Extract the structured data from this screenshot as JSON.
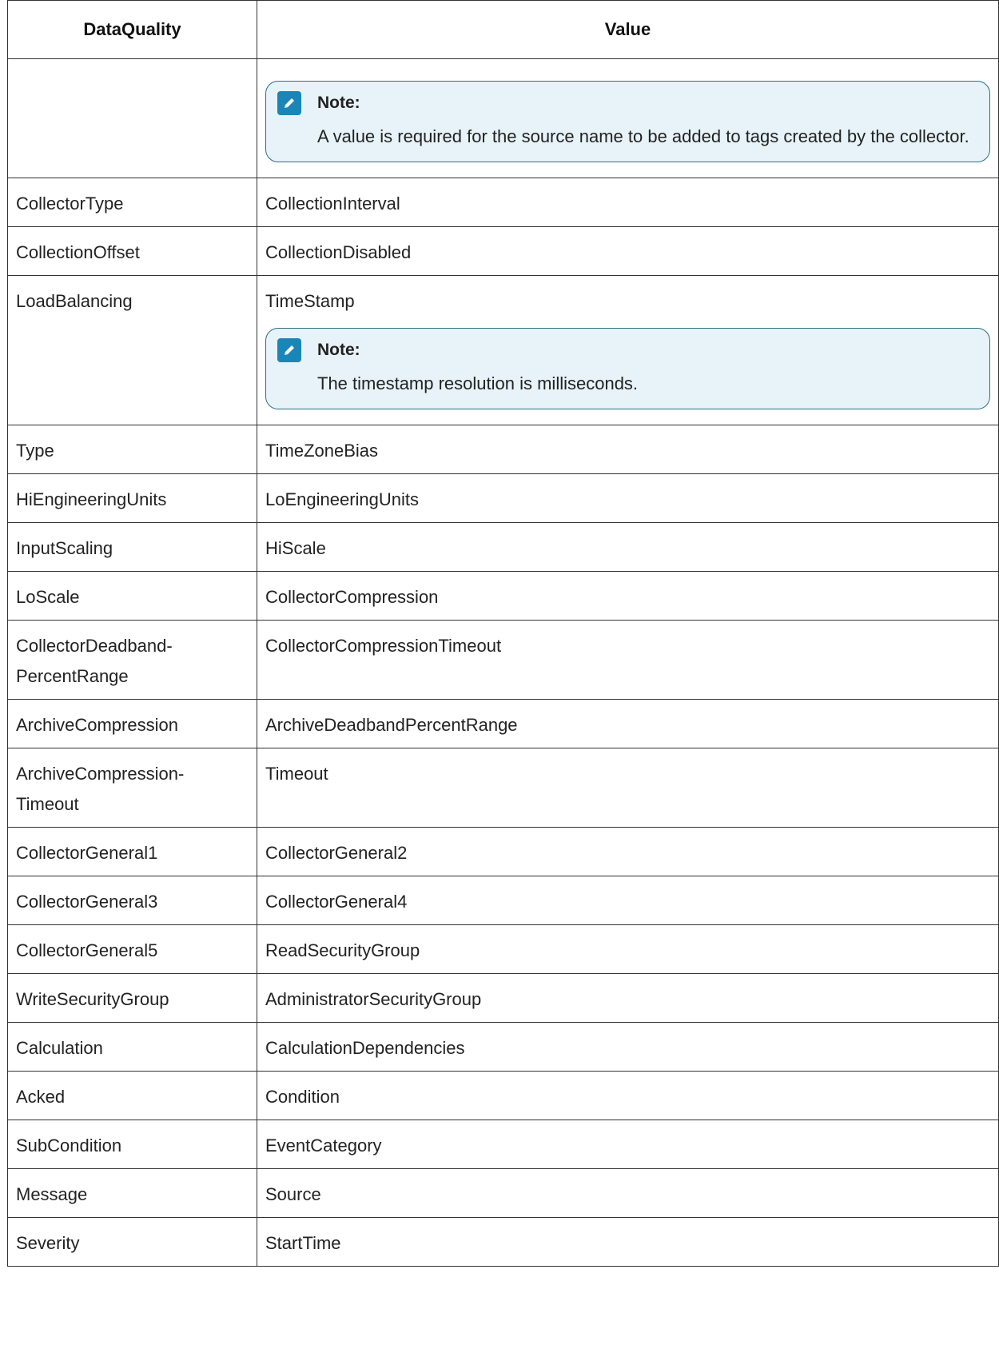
{
  "table": {
    "headers": [
      "DataQuality",
      "Value"
    ],
    "note_label": "Note:",
    "rows": [
      {
        "a": "",
        "b": "",
        "note": "A value is required for the source name to be added to tags created by the collector."
      },
      {
        "a": "CollectorType",
        "b": "CollectionInterval"
      },
      {
        "a": "CollectionOffset",
        "b": "CollectionDisabled"
      },
      {
        "a": "LoadBalancing",
        "b": "TimeStamp",
        "note": "The timestamp resolution is milliseconds."
      },
      {
        "a": "Type",
        "b": "TimeZoneBias"
      },
      {
        "a": "HiEngineeringUnits",
        "b": "LoEngineeringUnits"
      },
      {
        "a": "InputScaling",
        "b": "HiScale"
      },
      {
        "a": "LoScale",
        "b": "CollectorCompression"
      },
      {
        "a": "CollectorDeadband-\nPercentRange",
        "b": "CollectorCompressionTimeout"
      },
      {
        "a": "ArchiveCompression",
        "b": "ArchiveDeadbandPercentRange"
      },
      {
        "a": "ArchiveCompression-\nTimeout",
        "b": "Timeout"
      },
      {
        "a": "CollectorGeneral1",
        "b": "CollectorGeneral2"
      },
      {
        "a": "CollectorGeneral3",
        "b": "CollectorGeneral4"
      },
      {
        "a": "CollectorGeneral5",
        "b": "ReadSecurityGroup"
      },
      {
        "a": "WriteSecurityGroup",
        "b": "AdministratorSecurityGroup"
      },
      {
        "a": "Calculation",
        "b": "CalculationDependencies"
      },
      {
        "a": "Acked",
        "b": "Condition"
      },
      {
        "a": "SubCondition",
        "b": "EventCategory"
      },
      {
        "a": "Message",
        "b": "Source"
      },
      {
        "a": "Severity",
        "b": "StartTime"
      }
    ]
  }
}
